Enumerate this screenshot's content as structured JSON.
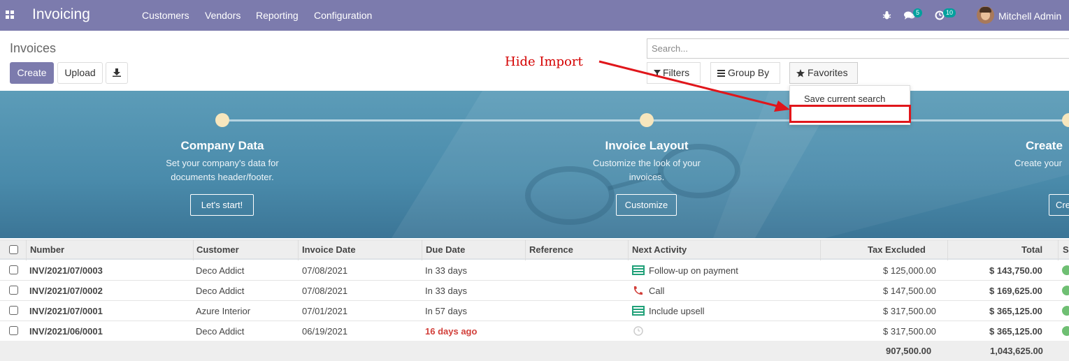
{
  "navbar": {
    "brand": "Invoicing",
    "menu": [
      "Customers",
      "Vendors",
      "Reporting",
      "Configuration"
    ],
    "messages_count": "5",
    "activities_count": "10",
    "user": "Mitchell Admin"
  },
  "control_panel": {
    "title": "Invoices",
    "create_label": "Create",
    "upload_label": "Upload",
    "search_placeholder": "Search...",
    "filters_label": "Filters",
    "group_by_label": "Group By",
    "favorites_label": "Favorites",
    "favorites_menu": {
      "save_search": "Save current search"
    }
  },
  "annotation": {
    "label": "Hide Import",
    "color": "#e0161b"
  },
  "onboarding": {
    "steps": [
      {
        "title": "Company Data",
        "desc_line1": "Set your company's data for",
        "desc_line2": "documents header/footer.",
        "button": "Let's start!"
      },
      {
        "title": "Invoice Layout",
        "desc_line1": "Customize the look of your",
        "desc_line2": "invoices.",
        "button": "Customize"
      },
      {
        "title": "Create",
        "desc_line1": "Create your",
        "desc_line2": "",
        "button": "Cre"
      }
    ]
  },
  "table": {
    "columns": [
      "Number",
      "Customer",
      "Invoice Date",
      "Due Date",
      "Reference",
      "Next Activity",
      "Tax Excluded",
      "Total",
      "S"
    ],
    "rows": [
      {
        "number": "INV/2021/07/0003",
        "customer": "Deco Addict",
        "invoice_date": "07/08/2021",
        "due_date": "In 33 days",
        "reference": "",
        "activity": "Follow-up on payment",
        "activity_icon": "todo-icon",
        "tax_excluded": "$ 125,000.00",
        "total": "$ 143,750.00"
      },
      {
        "number": "INV/2021/07/0002",
        "customer": "Deco Addict",
        "invoice_date": "07/08/2021",
        "due_date": "In 33 days",
        "reference": "",
        "activity": "Call",
        "activity_icon": "phone-icon",
        "tax_excluded": "$ 147,500.00",
        "total": "$ 169,625.00"
      },
      {
        "number": "INV/2021/07/0001",
        "customer": "Azure Interior",
        "invoice_date": "07/01/2021",
        "due_date": "In 57 days",
        "reference": "",
        "activity": "Include upsell",
        "activity_icon": "todo-icon",
        "tax_excluded": "$ 317,500.00",
        "total": "$ 365,125.00"
      },
      {
        "number": "INV/2021/06/0001",
        "customer": "Deco Addict",
        "invoice_date": "06/19/2021",
        "due_date": "16 days ago",
        "reference": "",
        "activity": "",
        "activity_icon": "clock-icon",
        "tax_excluded": "$ 317,500.00",
        "total": "$ 365,125.00"
      }
    ],
    "totals": {
      "tax_excluded": "907,500.00",
      "total": "1,043,625.00"
    }
  },
  "colors": {
    "navbar": "#7c7bad",
    "primary": "#7c7bad",
    "overdue": "#d23f3a",
    "activity_green": "#21a179",
    "badge": "#00a09d"
  }
}
